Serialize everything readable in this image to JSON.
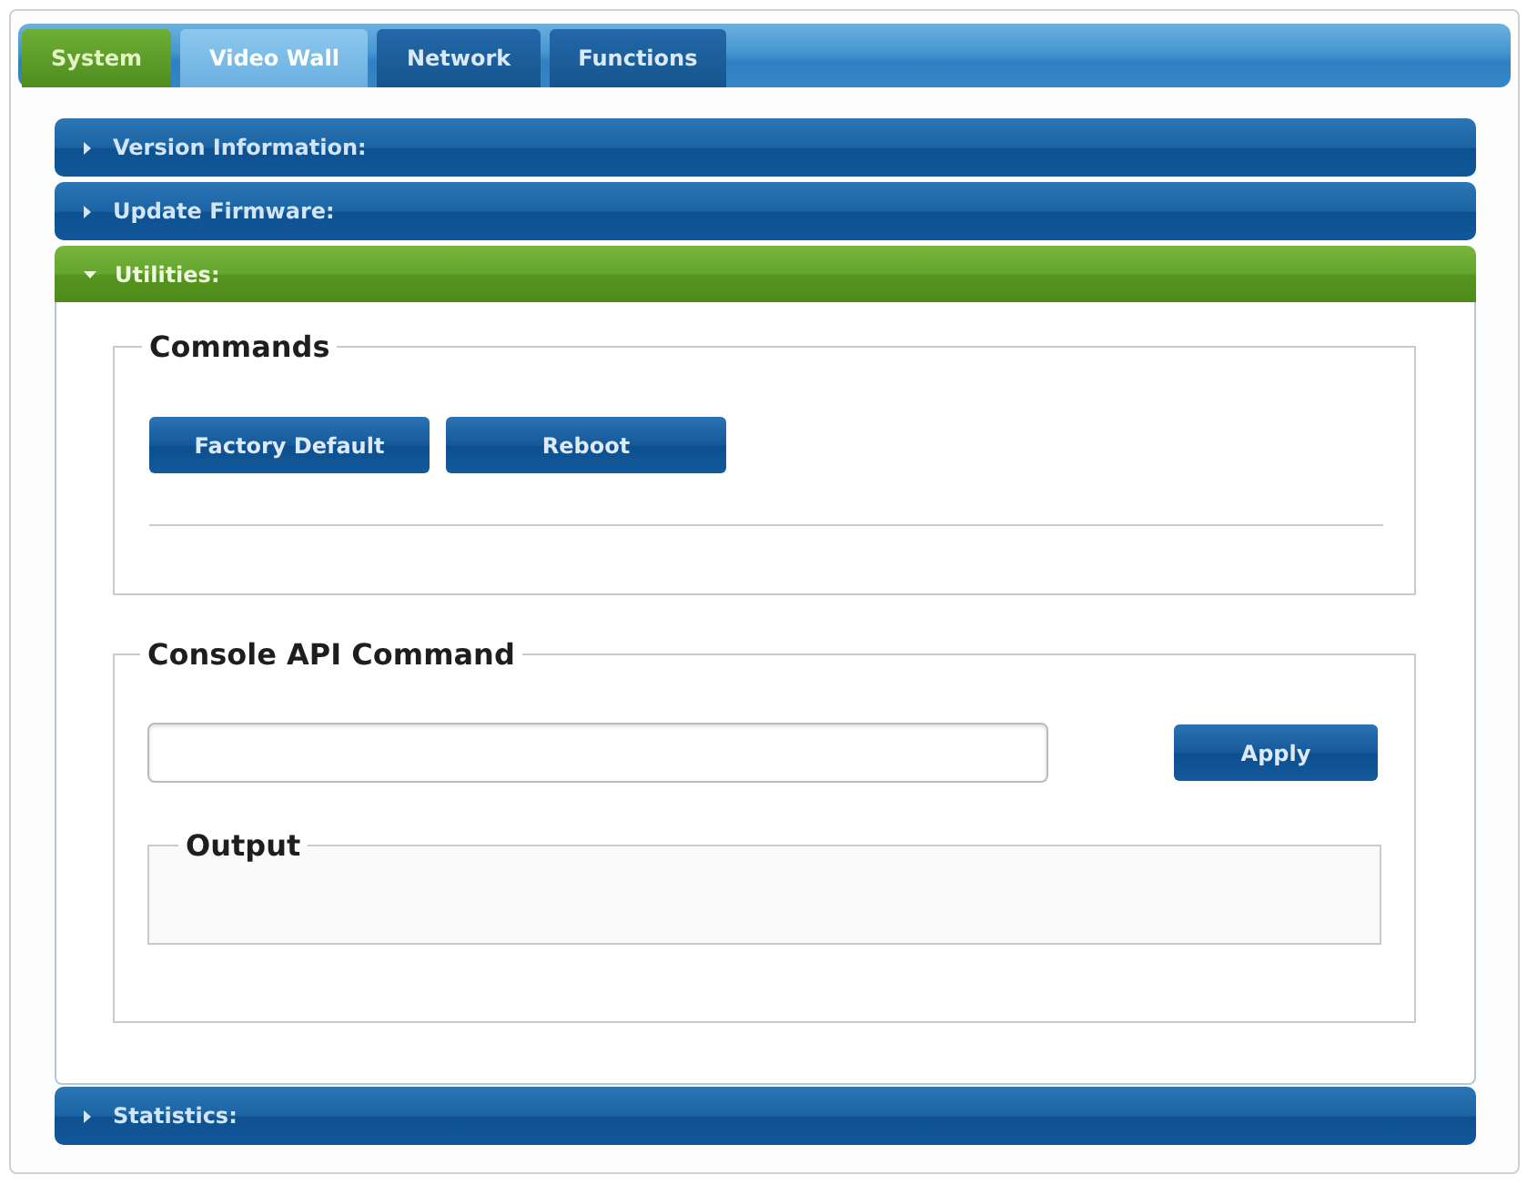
{
  "tabs": [
    {
      "label": "System",
      "selected": true,
      "highlighted": false
    },
    {
      "label": "Video Wall",
      "selected": false,
      "highlighted": true
    },
    {
      "label": "Network",
      "selected": false,
      "highlighted": false
    },
    {
      "label": "Functions",
      "selected": false,
      "highlighted": false
    }
  ],
  "sections": [
    {
      "title": "Version Information:",
      "expanded": false
    },
    {
      "title": "Update Firmware:",
      "expanded": false
    },
    {
      "title": "Utilities:",
      "expanded": true,
      "content": {
        "commands": {
          "legend": "Commands",
          "buttons": [
            "Factory Default",
            "Reboot"
          ]
        },
        "console": {
          "legend": "Console API Command",
          "apply_button": "Apply",
          "output_legend": "Output"
        }
      }
    },
    {
      "title": "Statistics:",
      "expanded": false
    }
  ]
}
